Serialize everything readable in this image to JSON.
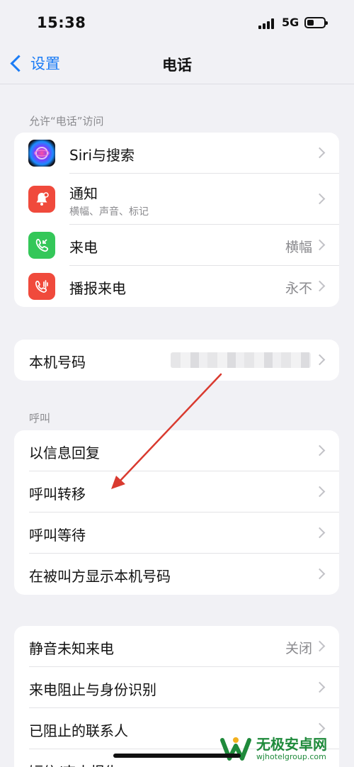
{
  "status_bar": {
    "time": "15:38",
    "network": "5G"
  },
  "nav": {
    "back_label": "设置",
    "title": "电话"
  },
  "section_access": {
    "header": "允许“电话”访问",
    "items": [
      {
        "label": "Siri与搜索",
        "icon": "siri-icon"
      },
      {
        "label": "通知",
        "sublabel": "横幅、声音、标记",
        "icon": "bell-icon"
      },
      {
        "label": "来电",
        "value": "横幅",
        "icon": "incoming-call-icon"
      },
      {
        "label": "播报来电",
        "value": "永不",
        "icon": "announce-call-icon"
      }
    ]
  },
  "my_number": {
    "label": "本机号码"
  },
  "section_calls": {
    "header": "呼叫",
    "items": [
      {
        "label": "以信息回复"
      },
      {
        "label": "呼叫转移"
      },
      {
        "label": "呼叫等待"
      },
      {
        "label": "在被叫方显示本机号码"
      }
    ]
  },
  "section_other": {
    "items": [
      {
        "label": "静音未知来电",
        "value": "关闭"
      },
      {
        "label": "来电阻止与身份识别"
      },
      {
        "label": "已阻止的联系人"
      },
      {
        "label": "短信/来电报告"
      }
    ]
  },
  "watermark": {
    "name": "无极安卓网",
    "url": "wjhotelgroup.com"
  },
  "colors": {
    "accent": "#1b7cf5",
    "annotation_arrow": "#d93a2f"
  }
}
